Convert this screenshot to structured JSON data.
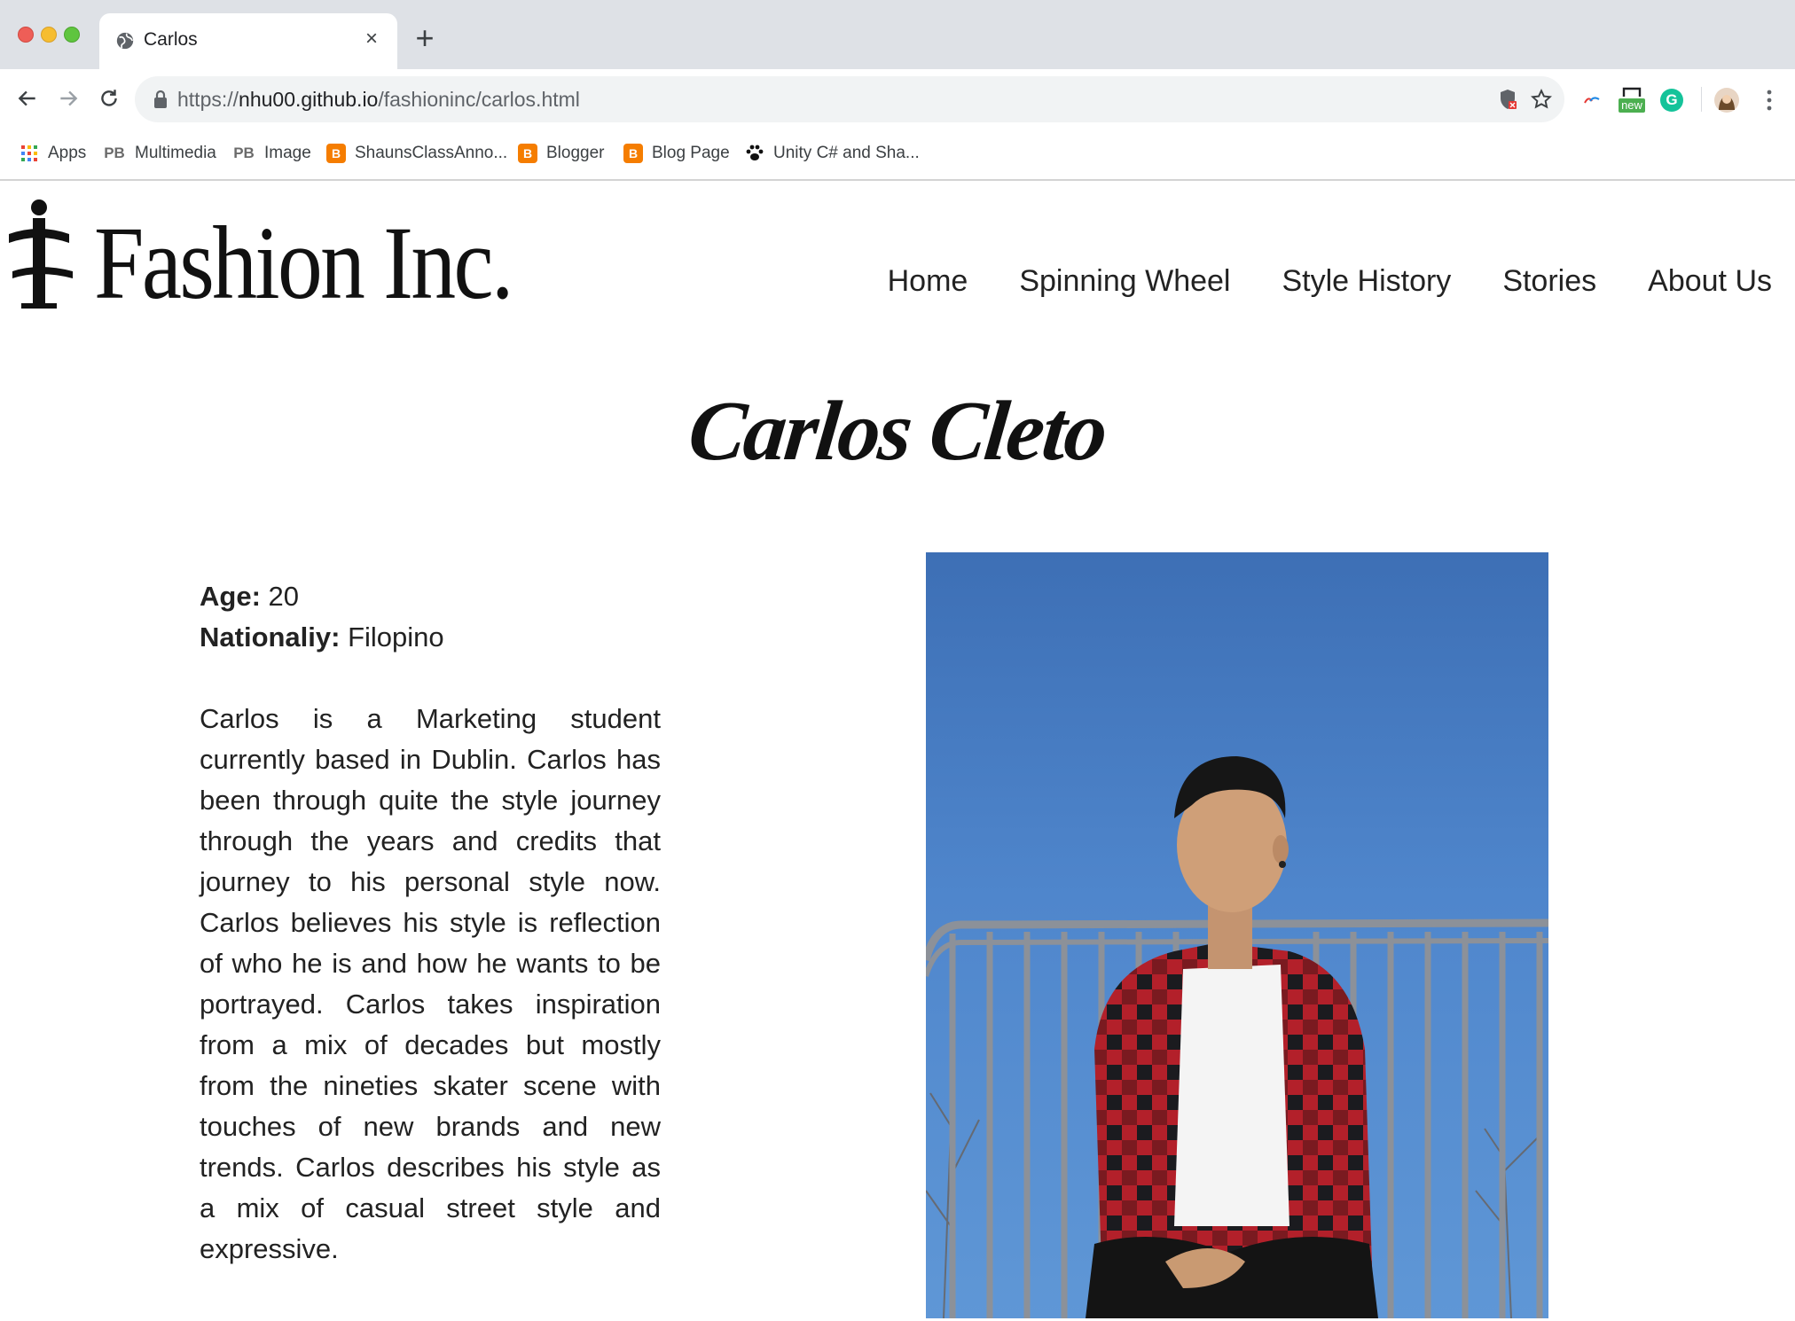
{
  "browser": {
    "tab": {
      "title": "Carlos",
      "close_glyph": "×"
    },
    "new_tab_glyph": "+",
    "address": {
      "scheme": "https://",
      "host": "nhu00.github.io",
      "path": "/fashioninc/carlos.html"
    },
    "extension_badge": "new",
    "extension_letter": "G",
    "bookmarks": [
      {
        "label": "Apps",
        "icon": "apps-grid-icon"
      },
      {
        "label": "Multimedia",
        "icon": "pb-icon",
        "icon_text": "PB"
      },
      {
        "label": "Image",
        "icon": "pb-icon",
        "icon_text": "PB"
      },
      {
        "label": "ShaunsClassAnno...",
        "icon": "blogger-icon"
      },
      {
        "label": "Blogger",
        "icon": "blogger-icon"
      },
      {
        "label": "Blog Page",
        "icon": "blogger-icon"
      },
      {
        "label": "Unity C# and Sha...",
        "icon": "paw-icon"
      }
    ]
  },
  "site": {
    "logo_text": "Fashion Inc.",
    "nav": [
      "Home",
      "Spinning Wheel",
      "Style History",
      "Stories",
      "About Us"
    ]
  },
  "profile": {
    "name": "Carlos Cleto",
    "age_label": "Age:",
    "age_value": " 20",
    "nationality_label": "Nationaliy:",
    "nationality_value": " Filopino",
    "description": "Carlos is a Marketing student currently based in Dublin. Carlos has been through quite the style journey through the years and credits that journey to his personal style now. Carlos believes his style is reflection of who he is and how he wants to be portrayed. Carlos takes inspiration from a mix of decades but mostly from the nineties skater scene with touches of new brands and new trends. Carlos describes his style as a mix of casual street style and expressive."
  },
  "colors": {
    "tabstrip": "#dee1e6",
    "omnibox": "#f1f3f4",
    "sky": "#4f86cc",
    "shirt_red": "#b3202a"
  }
}
